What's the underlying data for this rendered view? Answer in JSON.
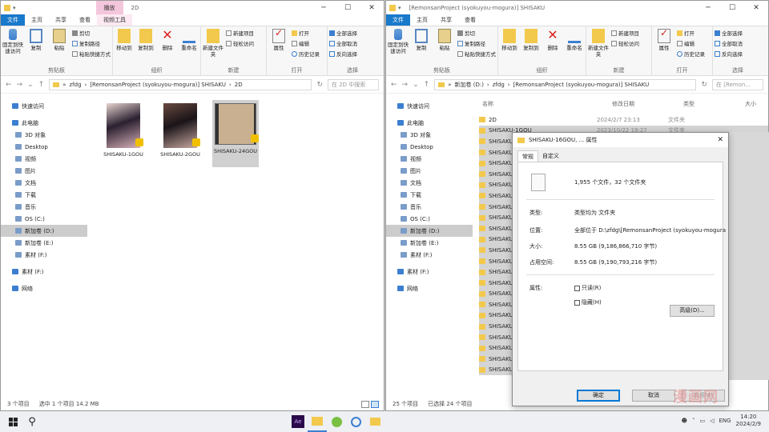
{
  "left": {
    "title": "2D",
    "ctx_tab": "播放",
    "tabs": [
      "文件",
      "主页",
      "共享",
      "查看",
      "视频工具"
    ],
    "ribbon": {
      "clip": {
        "pin": "固定到快速访问",
        "copy": "复制",
        "paste": "粘贴",
        "cut": "剪切",
        "copy_path": "复制路径",
        "paste_shortcut": "粘贴快捷方式",
        "label": "剪贴板"
      },
      "org": {
        "move": "移动到",
        "copyto": "复制到",
        "delete": "删除",
        "rename": "重命名",
        "label": "组织"
      },
      "new": {
        "folder": "新建文件夹",
        "label": "新建"
      },
      "open": {
        "props": "属性",
        "label": "打开"
      },
      "sel": {
        "all": "全部选择",
        "none": "全部取消",
        "invert": "反向选择",
        "label": "选择"
      },
      "new_item": "新建项目",
      "easy": "轻松访问",
      "open_btn": "打开",
      "edit": "编辑",
      "history": "历史记录"
    },
    "path": [
      "zfdg",
      "[RemonsanProject (syokuyou-mogura)] SHISAKU",
      "2D"
    ],
    "search": "在 2D 中搜索",
    "files": [
      "SHISAKU-1GOU",
      "SHISAKU-2GOU",
      "SHISAKU-24GOU"
    ],
    "status": {
      "count": "3 个项目",
      "sel": "选中 1 个项目  14.2 MB"
    }
  },
  "nav": [
    {
      "label": "快速访问",
      "top": true
    },
    {
      "label": "此电脑",
      "top": true,
      "gap": true
    },
    {
      "label": "3D 对象"
    },
    {
      "label": "Desktop"
    },
    {
      "label": "视频"
    },
    {
      "label": "图片"
    },
    {
      "label": "文档"
    },
    {
      "label": "下载"
    },
    {
      "label": "音乐"
    },
    {
      "label": "OS (C:)"
    },
    {
      "label": "新加卷 (D:)",
      "sel": true
    },
    {
      "label": "新加卷 (E:)"
    },
    {
      "label": "素材 (F:)"
    },
    {
      "label": "素材 (F:)",
      "top": true,
      "gap": true
    },
    {
      "label": "网络",
      "top": true,
      "gap": true
    }
  ],
  "right": {
    "title": "[RemonsanProject (syokuyou-mogura)] SHISAKU",
    "tabs": [
      "文件",
      "主页",
      "共享",
      "查看"
    ],
    "path": [
      "新加卷 (D:)",
      "zfdg",
      "[RemonsanProject (syokuyou-mogura)] SHISAKU"
    ],
    "search": "在 [Remon...",
    "headers": {
      "name": "名称",
      "date": "修改日期",
      "type": "类型",
      "size": "大小"
    },
    "rows": [
      {
        "name": "2D",
        "date": "2024/2/7 23:13",
        "type": "文件夹"
      },
      {
        "name": "SHISAKU-1GOU",
        "date": "2023/10/22 19:27",
        "type": "文件夹"
      },
      {
        "name": "SHISAKU"
      },
      {
        "name": "SHISAKU"
      },
      {
        "name": "SHISAKU"
      },
      {
        "name": "SHISAKU"
      },
      {
        "name": "SHISAKU"
      },
      {
        "name": "SHISAKU"
      },
      {
        "name": "SHISAKU"
      },
      {
        "name": "SHISAKU"
      },
      {
        "name": "SHISAKU"
      },
      {
        "name": "SHISAKU"
      },
      {
        "name": "SHISAKU"
      },
      {
        "name": "SHISAKU"
      },
      {
        "name": "SHISAKU"
      },
      {
        "name": "SHISAKU"
      },
      {
        "name": "SHISAKU"
      },
      {
        "name": "SHISAKU"
      },
      {
        "name": "SHISAKU"
      },
      {
        "name": "SHISAKU"
      },
      {
        "name": "SHISAKU"
      },
      {
        "name": "SHISAKU"
      },
      {
        "name": "SHISAKU"
      },
      {
        "name": "SHISAKU"
      }
    ],
    "status": {
      "count": "25 个项目",
      "sel": "已选择 24 个项目"
    }
  },
  "dialog": {
    "title": "SHISAKU-16GOU, ... 属性",
    "tabs": [
      "常规",
      "自定义"
    ],
    "summary": "1,955 个文件，32 个文件夹",
    "type_l": "类型:",
    "type_v": "类型均为 文件夹",
    "loc_l": "位置:",
    "loc_v": "全部位于 D:\\zfdg\\[RemonsanProject (syokuyou-mogura",
    "size_l": "大小:",
    "size_v": "8.55 GB (9,186,866,710 字节)",
    "disk_l": "占用空间:",
    "disk_v": "8.55 GB (9,190,793,216 字节)",
    "attr_l": "属性:",
    "readonly": "只读(R)",
    "hidden": "隐藏(H)",
    "advanced": "高级(D)...",
    "ok": "确定",
    "cancel": "取消",
    "apply": "应用(A)"
  },
  "taskbar": {
    "time": "14:20",
    "date": "2024/2/9",
    "lang": "ENG",
    "ae": "Ae"
  },
  "watermark": "漫画网",
  "colors": {
    "accent": "#1979ca",
    "ctx_tab": "#f4c6dc",
    "folder": "#f2c94c"
  }
}
